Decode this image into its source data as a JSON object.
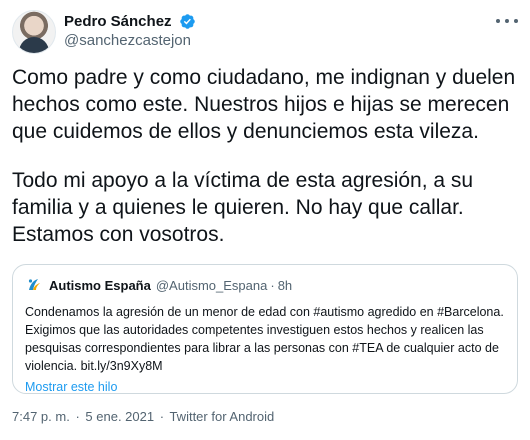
{
  "author": {
    "display_name": "Pedro Sánchez",
    "handle": "@sanchezcastejon",
    "verified": true
  },
  "tweet": {
    "paragraph_1": "Como padre y como ciudadano, me indignan y duelen hechos como este. Nuestros hijos e hijas se merecen que cuidemos de ellos y denunciemos esta vileza.",
    "paragraph_2": "Todo mi apoyo a la víctima de esta agresión, a su familia y a quienes le quieren. No hay que callar. Estamos con vosotros."
  },
  "quoted_tweet": {
    "display_name": "Autismo España",
    "handle": "@Autismo_Espana",
    "separator": "·",
    "time_ago": "8h",
    "text": "Condenamos la agresión de un menor de edad con #autismo agredido en #Barcelona. Exigimos que las autoridades competentes investiguen estos hechos y realicen las pesquisas correspondientes para librar a las personas con #TEA de cualquier acto de violencia. bit.ly/3n9Xy8M",
    "show_thread": "Mostrar este hilo"
  },
  "footer": {
    "time": "7:47 p. m.",
    "date": "5 ene. 2021",
    "source": "Twitter for Android",
    "separator": "·"
  },
  "colors": {
    "verified": "#1d9bf0",
    "link": "#1d9bf0",
    "secondary_text": "#536471",
    "border": "#cfd9de"
  },
  "icons": {
    "verified": "verified-badge-icon",
    "more": "more-options-icon",
    "quoted_avatar": "autismo-espana-logo-icon"
  }
}
